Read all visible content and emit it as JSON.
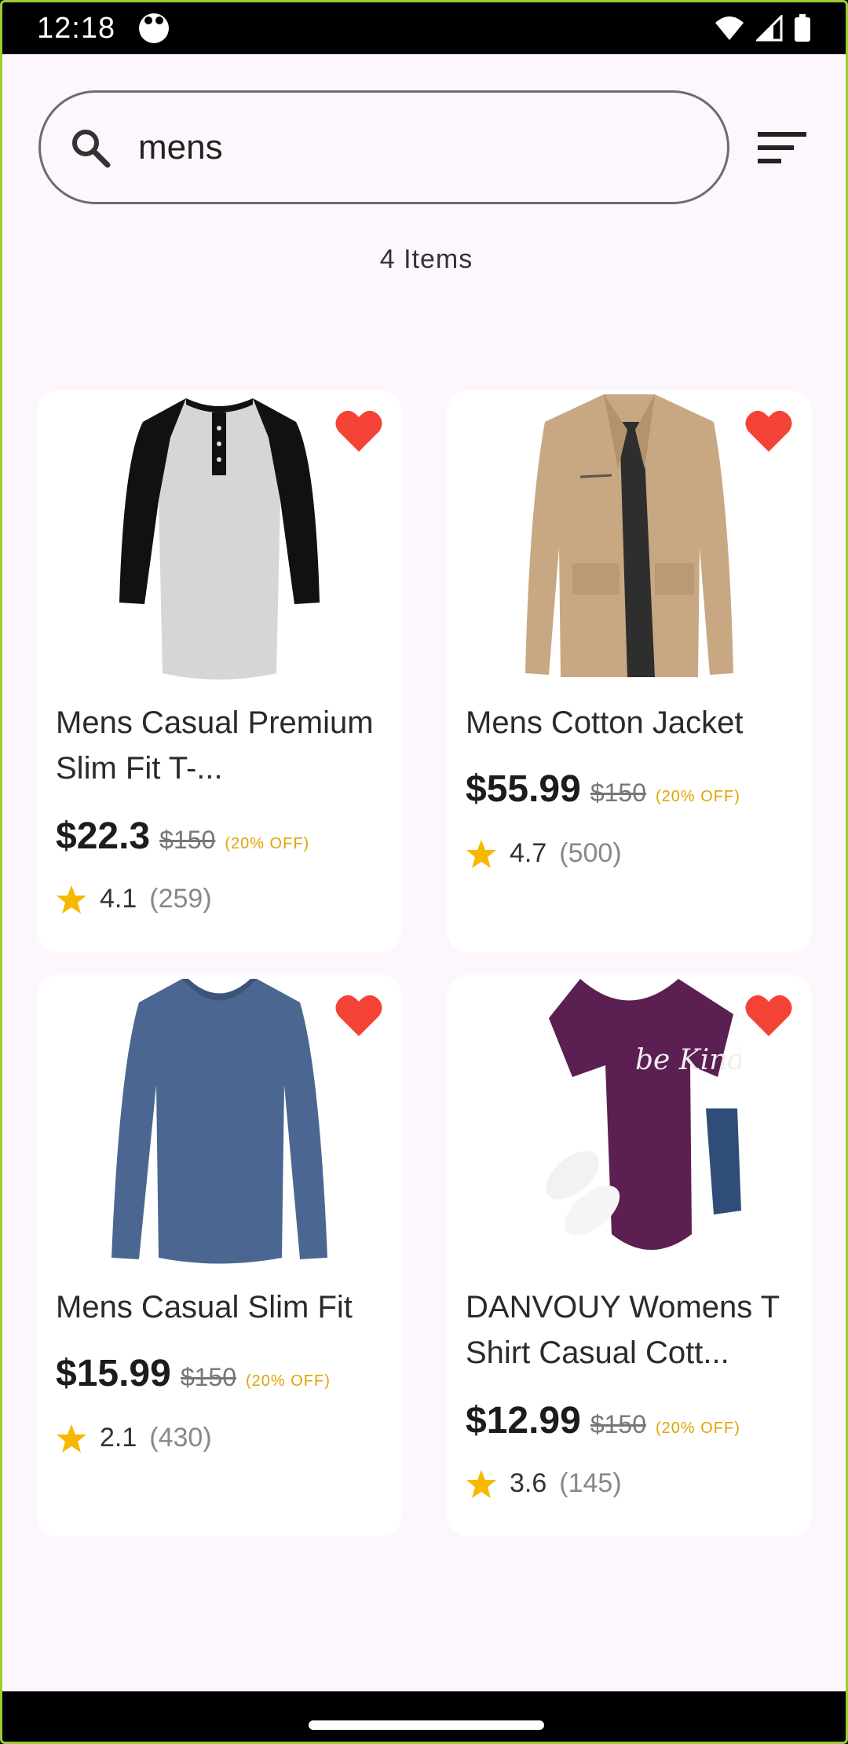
{
  "status": {
    "time": "12:18"
  },
  "search": {
    "value": "mens"
  },
  "items_count": "4 Items",
  "colors": {
    "heart": "#f44336",
    "star": "#f9b800",
    "discount": "#e0a300"
  },
  "products": [
    {
      "title": "Mens Casual Premium Slim Fit T-...",
      "price": "$22.3",
      "old_price": "$150",
      "discount": "(20% OFF)",
      "rating": "4.1",
      "reviews": "(259)",
      "favorite": true,
      "image": "henley-shirt"
    },
    {
      "title": "Mens Cotton Jacket",
      "price": "$55.99",
      "old_price": "$150",
      "discount": "(20% OFF)",
      "rating": "4.7",
      "reviews": "(500)",
      "favorite": true,
      "image": "khaki-jacket"
    },
    {
      "title": "Mens Casual Slim Fit",
      "price": "$15.99",
      "old_price": "$150",
      "discount": "(20% OFF)",
      "rating": "2.1",
      "reviews": "(430)",
      "favorite": true,
      "image": "blue-longsleeve"
    },
    {
      "title": "DANVOUY Womens T Shirt Casual Cott...",
      "price": "$12.99",
      "old_price": "$150",
      "discount": "(20% OFF)",
      "rating": "3.6",
      "reviews": "(145)",
      "favorite": true,
      "image": "purple-tshirt",
      "image_text": "be Kind"
    }
  ]
}
